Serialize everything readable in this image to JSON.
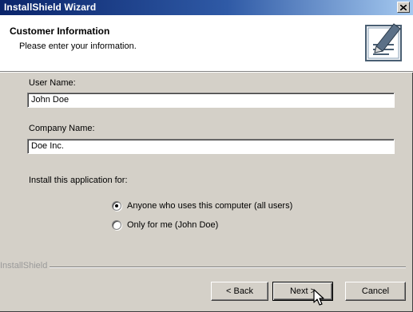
{
  "window": {
    "title": "InstallShield Wizard"
  },
  "header": {
    "title": "Customer Information",
    "subtitle": "Please enter your information.",
    "icon": "installer-form-icon"
  },
  "form": {
    "user_name_label": "User Name:",
    "user_name_value": "John Doe",
    "company_name_label": "Company Name:",
    "company_name_value": "Doe Inc.",
    "install_for_label": "Install this application for:",
    "options": [
      {
        "label": "Anyone who uses this computer (all users)",
        "selected": true
      },
      {
        "label": "Only for me (John Doe)",
        "selected": false
      }
    ]
  },
  "footer": {
    "brand": "InstallShield",
    "back_label": "< Back",
    "next_label": "Next >",
    "cancel_label": "Cancel"
  },
  "colors": {
    "titlebar_start": "#0a246a",
    "titlebar_end": "#a6caf0",
    "face": "#d4d0c8"
  }
}
